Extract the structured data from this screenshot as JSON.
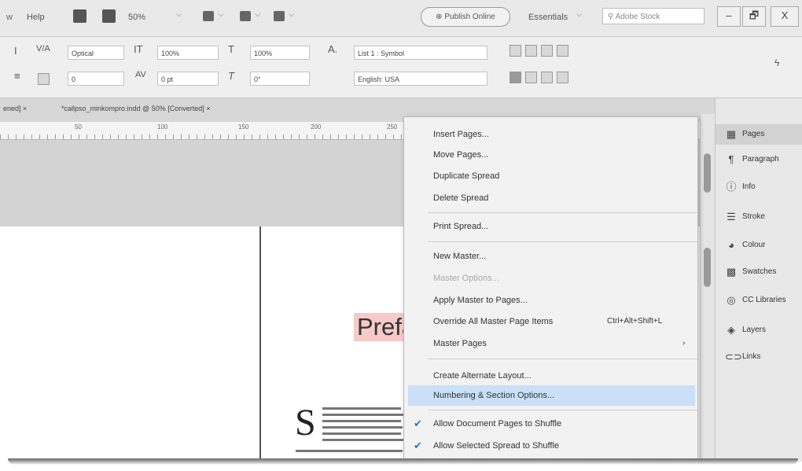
{
  "menubar": {
    "help": "Help",
    "zoom": "50%",
    "publish": "Publish Online",
    "workspace": "Essentials",
    "stock_search_placeholder": "Adobe Stock",
    "min": "–",
    "restore": "🗗",
    "close": "X"
  },
  "control": {
    "kerning": "Optical",
    "vscale": "100%",
    "hscale": "100%",
    "baseline": "0",
    "tracking": "0 pt",
    "skew": "0°",
    "style": "List 1 : Symbol",
    "language": "English: USA"
  },
  "tabs": {
    "tab1": "ened] ×",
    "tab2": "*callpso_minkompro.indd @ 50% [Converted] ×"
  },
  "ruler": [
    "50",
    "100",
    "150",
    "200",
    "250"
  ],
  "page": {
    "heading": "Prefa",
    "dropcap": "S"
  },
  "panel": {
    "items": [
      "Pages",
      "Paragraph",
      "Info",
      "Stroke",
      "Colour",
      "Swatches",
      "CC Libraries",
      "Layers",
      "Links"
    ]
  },
  "menu": {
    "insert_pages": "Insert Pages...",
    "move_pages": "Move Pages...",
    "duplicate_spread": "Duplicate Spread",
    "delete_spread": "Delete Spread",
    "print_spread": "Print Spread...",
    "new_master": "New Master...",
    "master_options": "Master Options...",
    "apply_master": "Apply Master to Pages...",
    "override_all": "Override All Master Page Items",
    "override_shortcut": "Ctrl+Alt+Shift+L",
    "master_pages": "Master Pages",
    "create_alt_layout": "Create Alternate Layout...",
    "numbering": "Numbering & Section Options...",
    "allow_doc_shuffle": "Allow Document Pages to Shuffle",
    "allow_spread_shuffle": "Allow Selected Spread to Shuffle"
  }
}
